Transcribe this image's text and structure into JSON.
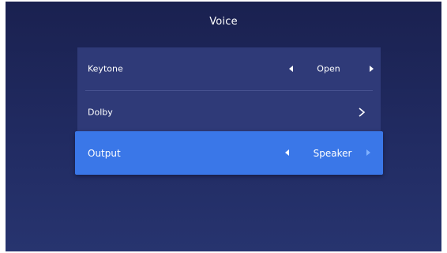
{
  "title": "Voice",
  "settings": {
    "keytone": {
      "label": "Keytone",
      "value": "Open"
    },
    "dolby": {
      "label": "Dolby"
    },
    "output": {
      "label": "Output",
      "value": "Speaker"
    }
  },
  "colors": {
    "background": "#212b62",
    "panel": "#2f3a78",
    "selected": "#3a77e8",
    "text": "#ffffff"
  },
  "icons": {
    "arrow_left": "triangle-left-icon",
    "arrow_right": "triangle-right-icon",
    "chevron": "chevron-right-icon"
  }
}
